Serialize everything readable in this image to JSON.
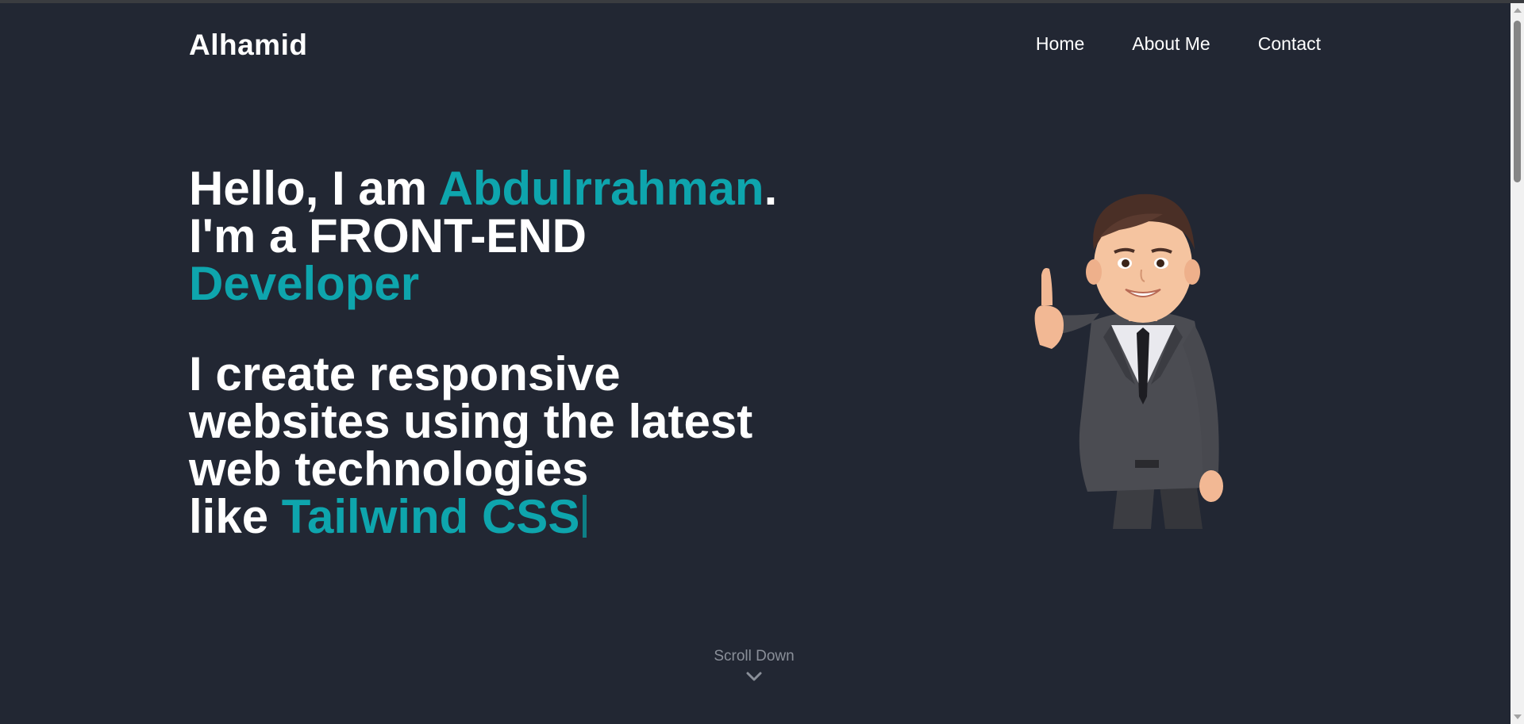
{
  "header": {
    "logo": "Alhamid",
    "nav": [
      {
        "label": "Home"
      },
      {
        "label": "About Me"
      },
      {
        "label": "Contact"
      }
    ]
  },
  "hero": {
    "greeting_prefix": "Hello, I am ",
    "name": "Abdulrrahman",
    "greeting_suffix": ".",
    "role_line": "I'm a FRONT-END",
    "role_accent": "Developer",
    "tagline_1": "I create responsive",
    "tagline_2": "websites using the latest",
    "tagline_3": "web technologies",
    "tagline_4_prefix": "like ",
    "typed_text": "Tailwind CSS"
  },
  "scroll": {
    "label": "Scroll Down",
    "icon": "chevron-down-icon"
  },
  "illustration": {
    "icon": "thumbs-up-character"
  },
  "colors": {
    "background": "#222733",
    "accent": "#0ea5ad",
    "text": "#ffffff",
    "muted": "#8a8f99"
  }
}
